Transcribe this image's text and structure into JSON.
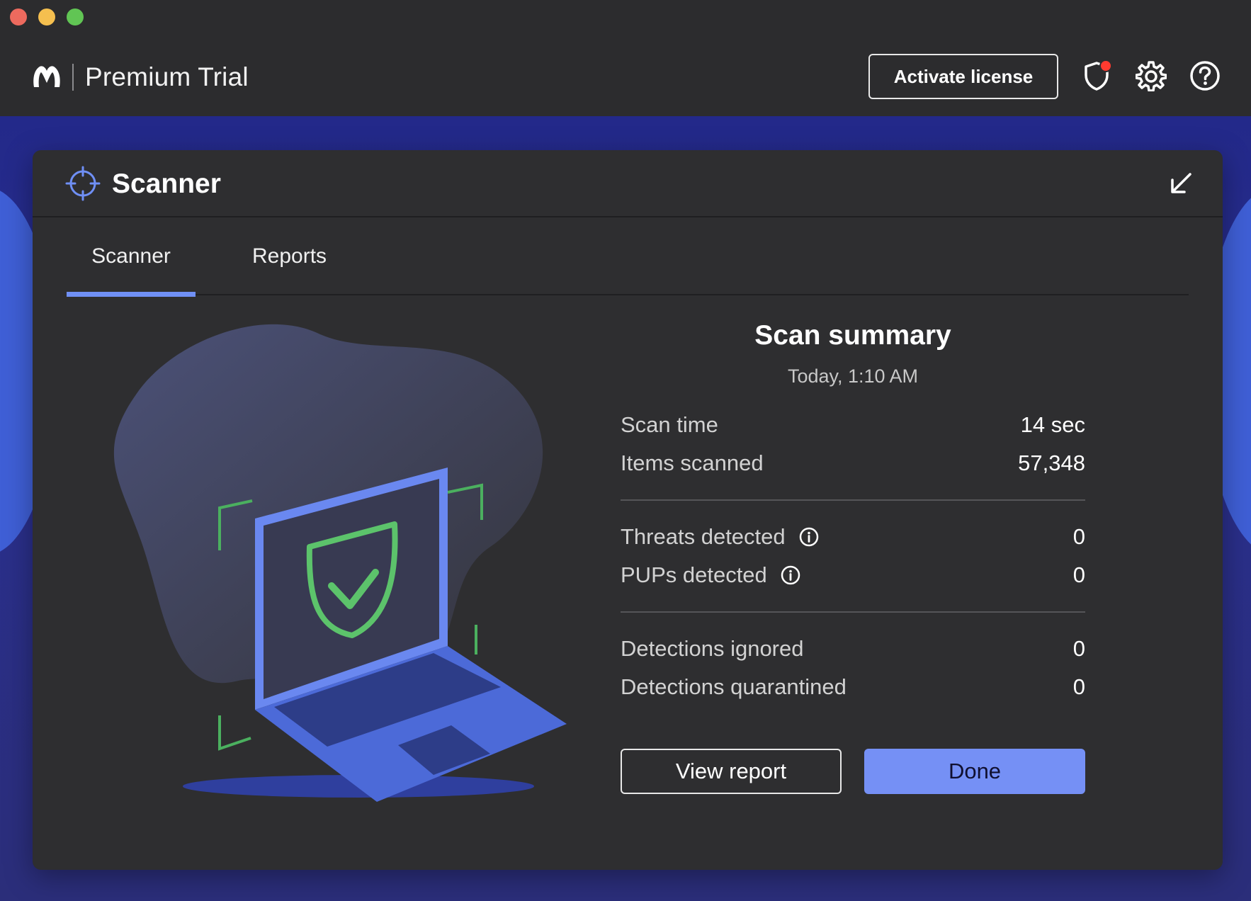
{
  "header": {
    "app_title": "Premium Trial",
    "activate_label": "Activate license",
    "icons": [
      "malwarebytes-logo-icon",
      "shield-alert-icon",
      "gear-icon",
      "help-icon"
    ],
    "notification_color": "#ff3b30"
  },
  "card": {
    "title": "Scanner",
    "icon": "crosshair-icon",
    "minimize_icon": "arrow-down-left-icon"
  },
  "tabs": [
    {
      "label": "Scanner",
      "active": true
    },
    {
      "label": "Reports",
      "active": false
    }
  ],
  "summary": {
    "heading": "Scan summary",
    "date": "Today, 1:10 AM",
    "groups": [
      [
        {
          "label": "Scan time",
          "value": "14 sec",
          "info": false
        },
        {
          "label": "Items scanned",
          "value": "57,348",
          "info": false
        }
      ],
      [
        {
          "label": "Threats detected",
          "value": "0",
          "info": true
        },
        {
          "label": "PUPs detected",
          "value": "0",
          "info": true
        }
      ],
      [
        {
          "label": "Detections ignored",
          "value": "0",
          "info": false
        },
        {
          "label": "Detections quarantined",
          "value": "0",
          "info": false
        }
      ]
    ]
  },
  "buttons": {
    "view_report": "View report",
    "done": "Done"
  },
  "colors": {
    "accent": "#7590f5",
    "success": "#5cc36b",
    "background": "#2e2e30"
  }
}
